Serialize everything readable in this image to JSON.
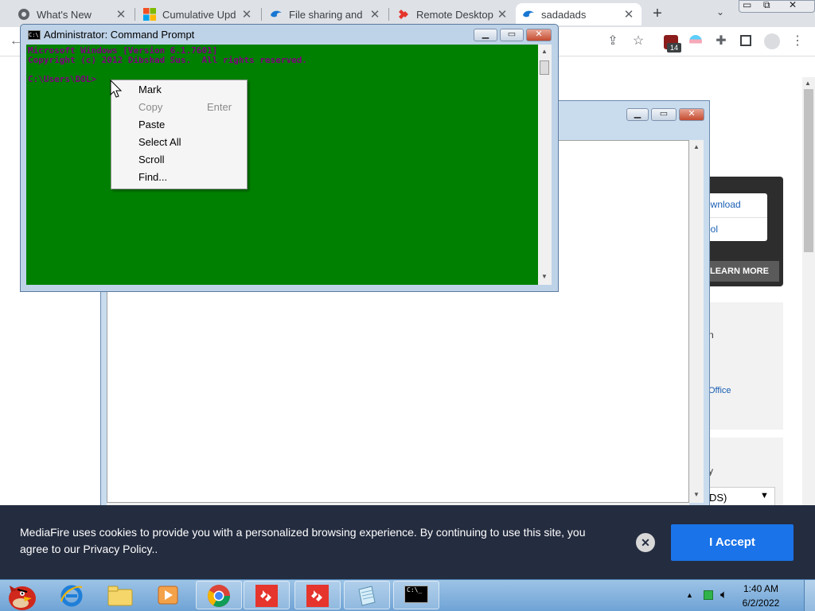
{
  "browser": {
    "tabs": [
      {
        "title": "What's New",
        "icon": "chrome-icon"
      },
      {
        "title": "Cumulative Upd",
        "icon": "windows-logo-icon"
      },
      {
        "title": "File sharing and",
        "icon": "mediafire-icon"
      },
      {
        "title": "Remote Desktop",
        "icon": "anydesk-icon"
      },
      {
        "title": "sadadads",
        "icon": "mediafire-icon"
      }
    ],
    "new_tab": "+",
    "extension_badge": "14"
  },
  "page": {
    "card_links": [
      "ownload",
      "pol"
    ],
    "learn_more": "LEARN MORE",
    "side_text_1": "n",
    "side_link_office": "Office",
    "side_text_2": "y",
    "dropdown_value": "DS)"
  },
  "cmd": {
    "title": "Administrator: Command Prompt",
    "lines": [
      "Microsoft Windows [Version 6.1.7601]",
      "Copyright (c) 2012 Dibshad Sus.  All rights reserved.",
      "",
      "C:\\Users\\DOL>"
    ]
  },
  "context_menu": {
    "items": [
      {
        "label": "Mark",
        "accel": "",
        "disabled": false
      },
      {
        "label": "Copy",
        "accel": "Enter",
        "disabled": true
      },
      {
        "label": "Paste",
        "accel": "",
        "disabled": false
      },
      {
        "label": "Select All",
        "accel": "",
        "disabled": false
      },
      {
        "label": "Scroll",
        "accel": "",
        "disabled": false
      },
      {
        "label": "Find...",
        "accel": "",
        "disabled": false
      }
    ]
  },
  "cookie_banner": {
    "text": "MediaFire uses cookies to provide you with a personalized browsing experience. By continuing to use this site, you agree to our Privacy Policy..",
    "accept": "I Accept",
    "close": "✕"
  },
  "taskbar": {
    "time": "1:40 AM",
    "date": "6/2/2022",
    "apps": [
      "angry-birds-icon",
      "internet-explorer-icon",
      "folder-icon",
      "media-player-icon",
      "chrome-icon",
      "anydesk-icon",
      "anydesk-icon",
      "notepad-icon",
      "cmd-icon"
    ],
    "cmd_icon_text": "C:\\_"
  },
  "colors": {
    "cmd_background": "#008000",
    "cmd_text": "#800080",
    "accept_button": "#1a73e8",
    "cookie_banner": "#242c3f"
  }
}
